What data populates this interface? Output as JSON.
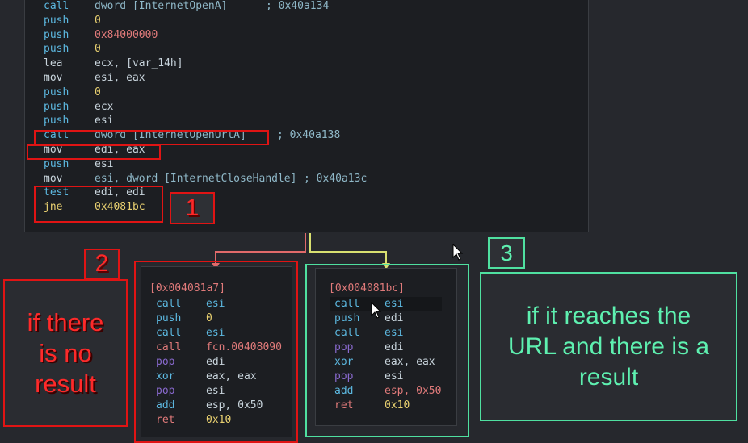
{
  "main_block": {
    "lines": [
      {
        "mnemonic": "call",
        "operand": "dword [InternetOpenA]",
        "comment": "; 0x40a134",
        "mcolor": "#5cb8e0",
        "ocolor": "#8fb8c8"
      },
      {
        "mnemonic": "push",
        "operand": "0",
        "comment": "",
        "mcolor": "#5cb8e0",
        "ocolor": "#e8d070"
      },
      {
        "mnemonic": "push",
        "operand": "0x84000000",
        "comment": "",
        "mcolor": "#5cb8e0",
        "ocolor": "#e07a7a"
      },
      {
        "mnemonic": "push",
        "operand": "0",
        "comment": "",
        "mcolor": "#5cb8e0",
        "ocolor": "#e8d070"
      },
      {
        "mnemonic": "lea",
        "operand": "ecx, [var_14h]",
        "comment": "",
        "mcolor": "#c8d4dc",
        "ocolor": "#c8d4dc"
      },
      {
        "mnemonic": "mov",
        "operand": "esi, eax",
        "comment": "",
        "mcolor": "#c8d4dc",
        "ocolor": "#c8d4dc"
      },
      {
        "mnemonic": "push",
        "operand": "0",
        "comment": "",
        "mcolor": "#5cb8e0",
        "ocolor": "#e8d070"
      },
      {
        "mnemonic": "push",
        "operand": "ecx",
        "comment": "",
        "mcolor": "#5cb8e0",
        "ocolor": "#c8d4dc"
      },
      {
        "mnemonic": "push",
        "operand": "esi",
        "comment": "",
        "mcolor": "#5cb8e0",
        "ocolor": "#c8d4dc"
      },
      {
        "mnemonic": "call",
        "operand": "dword [InternetOpenUrlA]",
        "comment": "; 0x40a138",
        "mcolor": "#5cb8e0",
        "ocolor": "#8fb8c8"
      },
      {
        "mnemonic": "mov",
        "operand": "edi, eax",
        "comment": "",
        "mcolor": "#c8d4dc",
        "ocolor": "#c8d4dc"
      },
      {
        "mnemonic": "push",
        "operand": "esi",
        "comment": "",
        "mcolor": "#5cb8e0",
        "ocolor": "#c8d4dc"
      },
      {
        "mnemonic": "mov",
        "operand": "esi, dword [InternetCloseHandle]",
        "comment": "; 0x40a13c",
        "mcolor": "#c8d4dc",
        "ocolor": "#8fb8c8"
      },
      {
        "mnemonic": "test",
        "operand": "edi, edi",
        "comment": "",
        "mcolor": "#5cb8e0",
        "ocolor": "#c8d4dc"
      },
      {
        "mnemonic": "jne",
        "operand": "0x4081bc",
        "comment": "",
        "mcolor": "#e8d070",
        "ocolor": "#e8d070"
      }
    ]
  },
  "left_block": {
    "header": "[0x004081a7]",
    "lines": [
      {
        "mnemonic": "call",
        "operand": "esi",
        "mcolor": "#5cb8e0",
        "ocolor": "#5cb8e0"
      },
      {
        "mnemonic": "push",
        "operand": "0",
        "mcolor": "#5cb8e0",
        "ocolor": "#e8d070"
      },
      {
        "mnemonic": "call",
        "operand": "esi",
        "mcolor": "#5cb8e0",
        "ocolor": "#5cb8e0"
      },
      {
        "mnemonic": "call",
        "operand": "fcn.00408090",
        "mcolor": "#e07a7a",
        "ocolor": "#e07a7a"
      },
      {
        "mnemonic": "pop",
        "operand": "edi",
        "mcolor": "#8a6ad0",
        "ocolor": "#c8d4dc"
      },
      {
        "mnemonic": "xor",
        "operand": "eax, eax",
        "mcolor": "#5cb8e0",
        "ocolor": "#c8d4dc"
      },
      {
        "mnemonic": "pop",
        "operand": "esi",
        "mcolor": "#8a6ad0",
        "ocolor": "#c8d4dc"
      },
      {
        "mnemonic": "add",
        "operand": "esp, 0x50",
        "mcolor": "#5cb8e0",
        "ocolor": "#c8d4dc"
      },
      {
        "mnemonic": "ret",
        "operand": "0x10",
        "mcolor": "#e07a7a",
        "ocolor": "#e8d070"
      }
    ]
  },
  "right_block": {
    "header": "[0x004081bc]",
    "lines": [
      {
        "mnemonic": "call",
        "operand": "esi",
        "mcolor": "#5cb8e0",
        "ocolor": "#5cb8e0"
      },
      {
        "mnemonic": "push",
        "operand": "edi",
        "mcolor": "#5cb8e0",
        "ocolor": "#c8d4dc"
      },
      {
        "mnemonic": "call",
        "operand": "esi",
        "mcolor": "#5cb8e0",
        "ocolor": "#5cb8e0"
      },
      {
        "mnemonic": "pop",
        "operand": "edi",
        "mcolor": "#8a6ad0",
        "ocolor": "#c8d4dc"
      },
      {
        "mnemonic": "xor",
        "operand": "eax, eax",
        "mcolor": "#5cb8e0",
        "ocolor": "#c8d4dc"
      },
      {
        "mnemonic": "pop",
        "operand": "esi",
        "mcolor": "#8a6ad0",
        "ocolor": "#c8d4dc"
      },
      {
        "mnemonic": "add",
        "operand": "esp, 0x50",
        "mcolor": "#5cb8e0",
        "ocolor": "#e07a7a"
      },
      {
        "mnemonic": "ret",
        "operand": "0x10",
        "mcolor": "#e07a7a",
        "ocolor": "#e8d070"
      }
    ]
  },
  "annotations": {
    "badge_1": "1",
    "badge_2": "2",
    "badge_3": "3",
    "note_no_result_line1": "if there",
    "note_no_result_line2": "is no",
    "note_no_result_line3": "result",
    "note_result_line1": "if it reaches the",
    "note_result_line2": "URL and there is a",
    "note_result_line3": "result"
  },
  "colors": {
    "background": "#26282d",
    "block_bg": "#1c1e22",
    "highlight_red": "#e01414",
    "highlight_green": "#4fe0a0",
    "edge_false": "#e06a6a",
    "edge_true": "#d8e070"
  }
}
